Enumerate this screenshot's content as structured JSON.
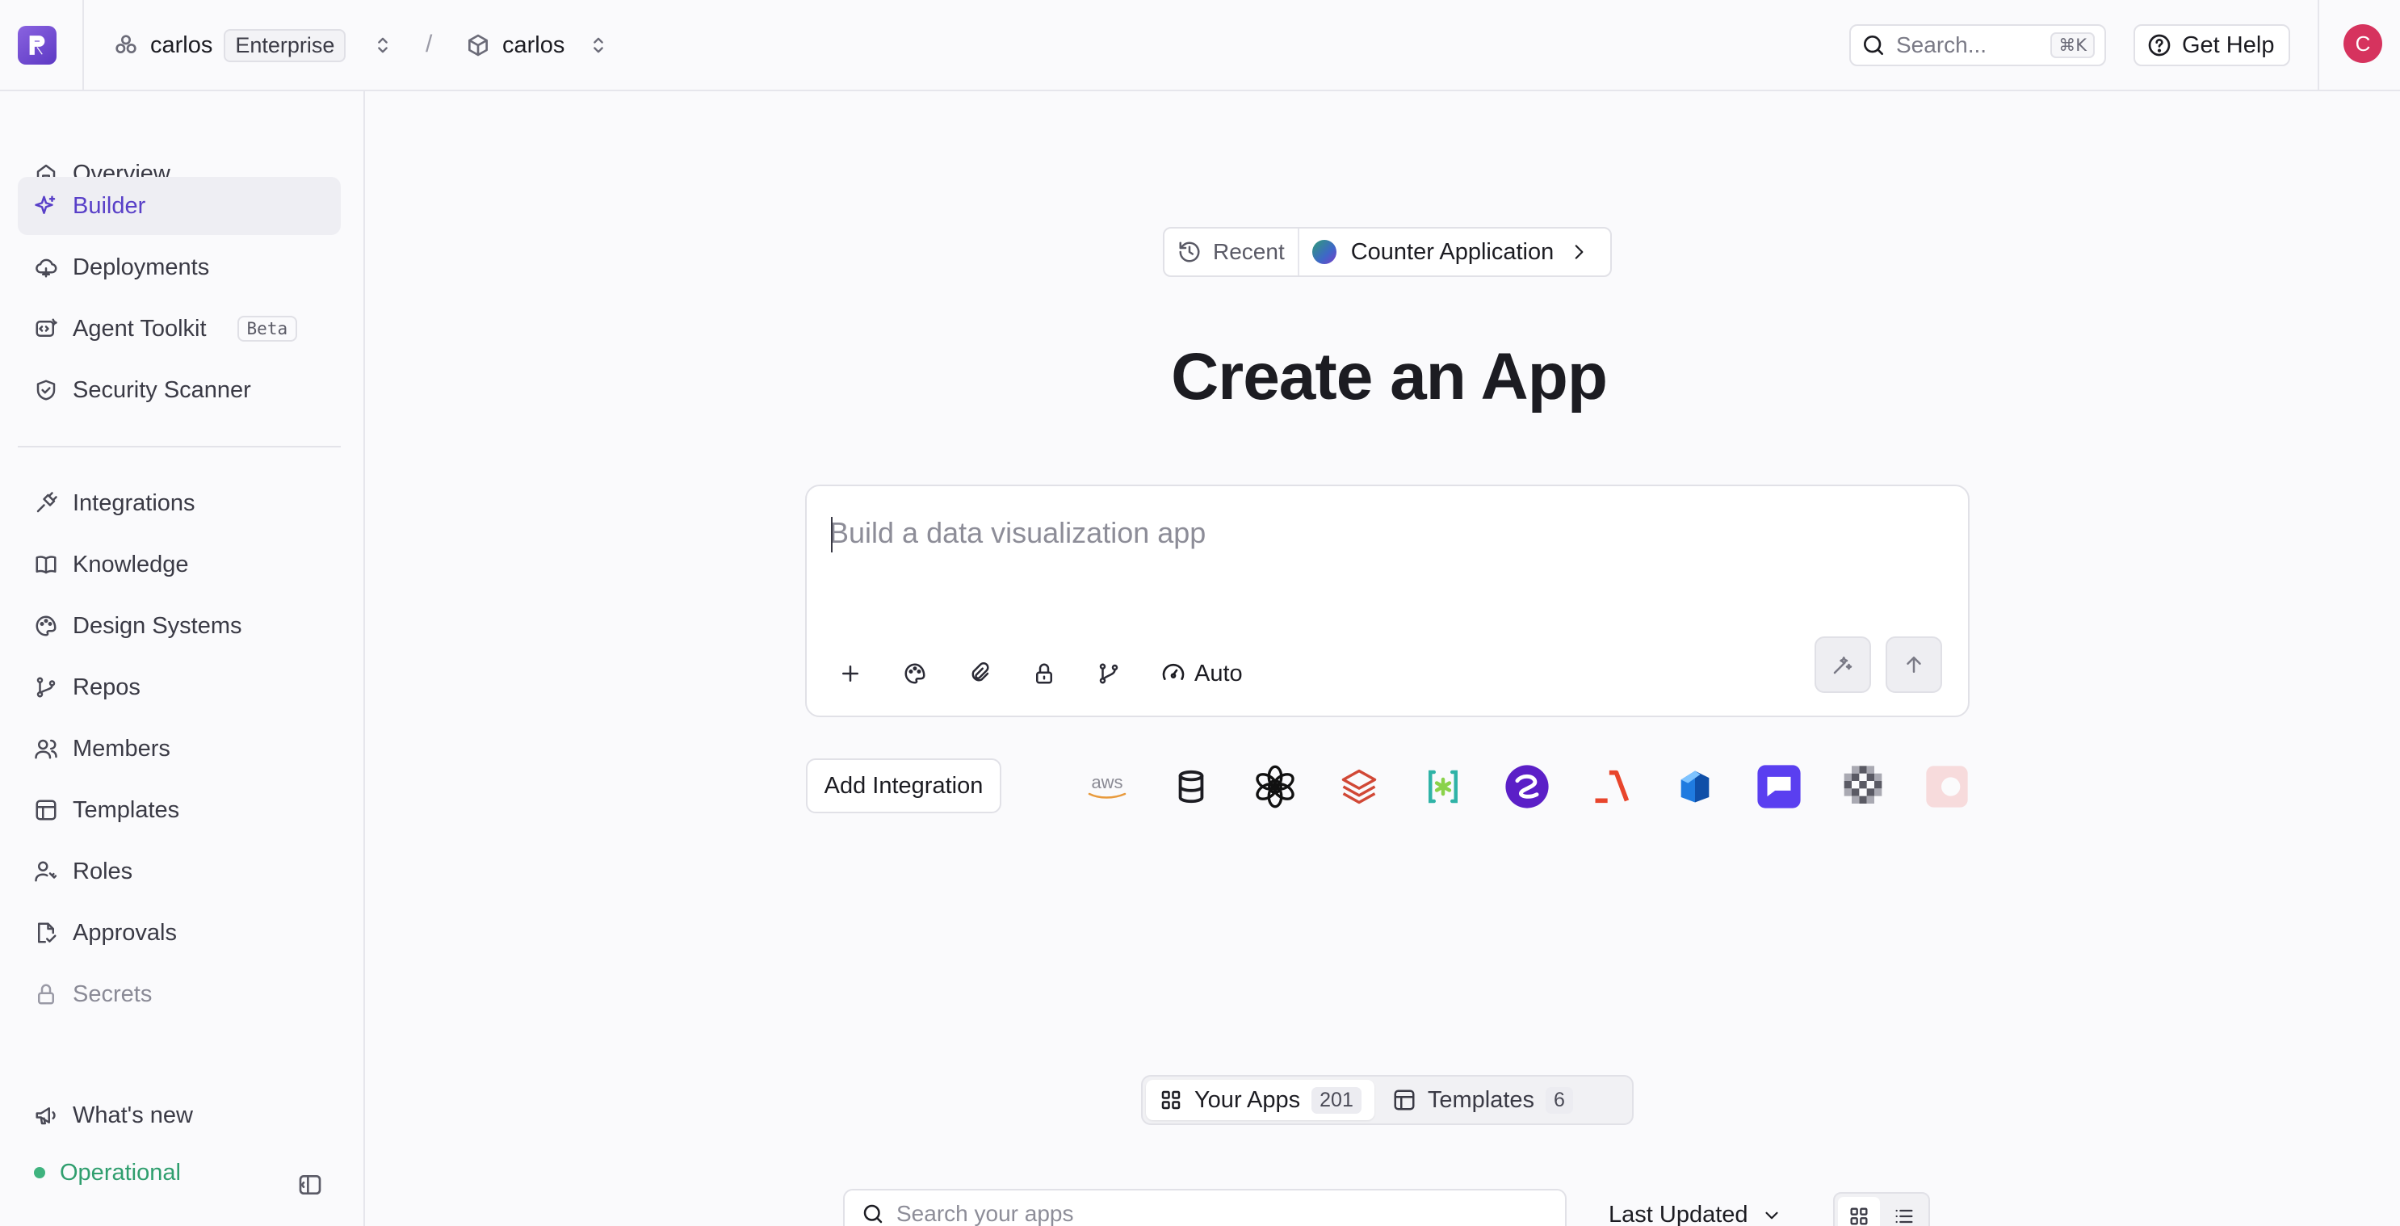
{
  "topbar": {
    "workspace": "carlos",
    "plan_badge": "Enterprise",
    "separator": "/",
    "project": "carlos",
    "search_placeholder": "Search...",
    "search_shortcut": "⌘K",
    "help_label": "Get Help",
    "avatar_initial": "C"
  },
  "sidebar": {
    "items": [
      {
        "label": "Overview",
        "icon": "home-icon"
      },
      {
        "label": "Builder",
        "icon": "sparkle-icon",
        "active": true
      },
      {
        "label": "Deployments",
        "icon": "cloud-icon"
      },
      {
        "label": "Agent Toolkit",
        "icon": "agent-icon",
        "badge": "Beta"
      },
      {
        "label": "Security Scanner",
        "icon": "shield-icon"
      },
      {
        "label": "Integrations",
        "icon": "plug-icon"
      },
      {
        "label": "Knowledge",
        "icon": "book-icon"
      },
      {
        "label": "Design Systems",
        "icon": "palette-icon"
      },
      {
        "label": "Repos",
        "icon": "git-branch-icon"
      },
      {
        "label": "Members",
        "icon": "users-icon"
      },
      {
        "label": "Templates",
        "icon": "template-icon"
      },
      {
        "label": "Roles",
        "icon": "user-key-icon"
      },
      {
        "label": "Approvals",
        "icon": "approval-icon"
      },
      {
        "label": "Secrets",
        "icon": "lock-icon"
      },
      {
        "label": "What's new",
        "icon": "megaphone-icon"
      }
    ],
    "status": "Operational",
    "status_color": "#3fb37f"
  },
  "main": {
    "recent_label": "Recent",
    "recent_app": "Counter Application",
    "title": "Create an App",
    "prompt_placeholder": "Build a data visualization app",
    "mode_label": "Auto",
    "add_integration_label": "Add Integration",
    "integration_logos": [
      "aws-logo",
      "database-icon",
      "openai-logo",
      "databricks-logo",
      "bracket-logo",
      "circle-logo",
      "lambda-logo",
      "cube-logo",
      "chat-logo",
      "checker-logo",
      "faded-logo"
    ],
    "tabs": [
      {
        "label": "Your Apps",
        "count": "201"
      },
      {
        "label": "Templates",
        "count": "6"
      }
    ],
    "apps_search_placeholder": "Search your apps",
    "sort_label": "Last Updated",
    "accent_color": "#5940c8"
  }
}
